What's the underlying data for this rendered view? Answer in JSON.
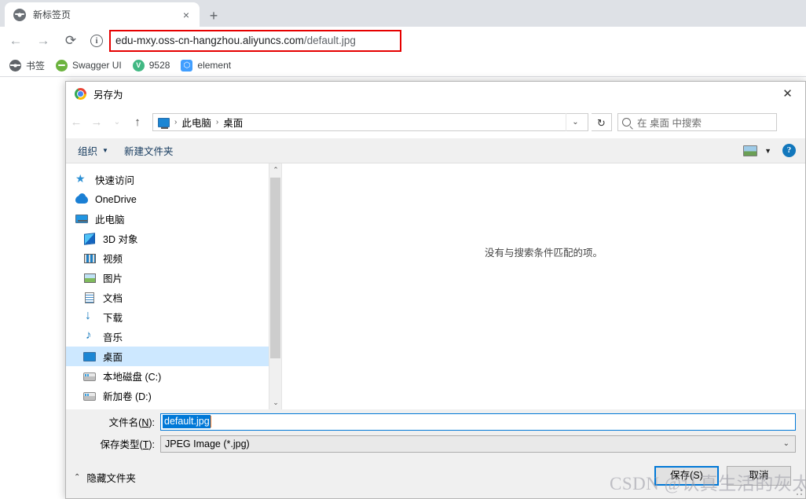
{
  "browser": {
    "tab": {
      "title": "新标签页",
      "favicon": "globe-icon",
      "close": "×"
    },
    "new_tab": "+",
    "nav": {
      "back": "←",
      "forward": "→",
      "reload": "⟳"
    },
    "omnibox": {
      "info_icon_glyph": "i",
      "url_domain": "edu-mxy.oss-cn-hangzhou.aliyuncs.com",
      "url_path": "/default.jpg",
      "highlight_color": "#e60000"
    },
    "bookmarks": [
      {
        "label": "书签",
        "icon": "globe-icon"
      },
      {
        "label": "Swagger UI",
        "icon": "swagger-icon"
      },
      {
        "label": "9528",
        "icon": "vue-icon"
      },
      {
        "label": "element",
        "icon": "element-icon"
      }
    ]
  },
  "dialog": {
    "title": "另存为",
    "app_icon": "chrome-logo-icon",
    "close_glyph": "✕",
    "nav": {
      "back": "←",
      "forward": "→",
      "recent": "⌄",
      "up": "↑",
      "refresh": "↻",
      "crumb_chevron": "⌄"
    },
    "breadcrumb": {
      "root_icon": "this-pc-icon",
      "items": [
        "此电脑",
        "桌面"
      ],
      "separator": "›"
    },
    "search": {
      "placeholder": "在 桌面 中搜索",
      "icon": "search-icon"
    },
    "commandbar": {
      "organize": "组织",
      "organize_caret": "▼",
      "new_folder": "新建文件夹",
      "view_icon": "view-layout-icon",
      "view_caret": "▼",
      "help": "?"
    },
    "nav_pane": {
      "items": [
        {
          "label": "快速访问",
          "icon": "pin-icon",
          "indent": false,
          "selected": false
        },
        {
          "label": "OneDrive",
          "icon": "cloud-icon",
          "indent": false,
          "selected": false
        },
        {
          "label": "此电脑",
          "icon": "this-pc-icon",
          "indent": false,
          "selected": false
        },
        {
          "label": "3D 对象",
          "icon": "3d-objects-icon",
          "indent": true,
          "selected": false
        },
        {
          "label": "视频",
          "icon": "videos-icon",
          "indent": true,
          "selected": false
        },
        {
          "label": "图片",
          "icon": "pictures-icon",
          "indent": true,
          "selected": false
        },
        {
          "label": "文档",
          "icon": "documents-icon",
          "indent": true,
          "selected": false
        },
        {
          "label": "下载",
          "icon": "downloads-icon",
          "indent": true,
          "selected": false
        },
        {
          "label": "音乐",
          "icon": "music-icon",
          "indent": true,
          "selected": false
        },
        {
          "label": "桌面",
          "icon": "desktop-icon",
          "indent": true,
          "selected": true
        },
        {
          "label": "本地磁盘 (C:)",
          "icon": "disk-icon",
          "indent": true,
          "selected": false
        },
        {
          "label": "新加卷 (D:)",
          "icon": "disk-icon",
          "indent": true,
          "selected": false
        }
      ],
      "scrollbar": {
        "up": "⌃",
        "down": "⌄"
      }
    },
    "file_list": {
      "empty_message": "没有与搜索条件匹配的项。"
    },
    "form": {
      "filename_label": "文件名(N):",
      "filename_label_plain": "文件名",
      "filename_accel": "N",
      "filename_value": "default.jpg",
      "savetype_label": "保存类型(T):",
      "savetype_label_plain": "保存类型",
      "savetype_accel": "T",
      "savetype_value": "JPEG Image (*.jpg)",
      "savetype_caret": "⌄"
    },
    "footer": {
      "hide_folders": "隐藏文件夹",
      "hide_folders_caret": "⌃",
      "save_button": "保存(S)",
      "cancel_button": "取消"
    }
  },
  "watermark": {
    "text": "CSDN @认真生活的灰太狼"
  }
}
